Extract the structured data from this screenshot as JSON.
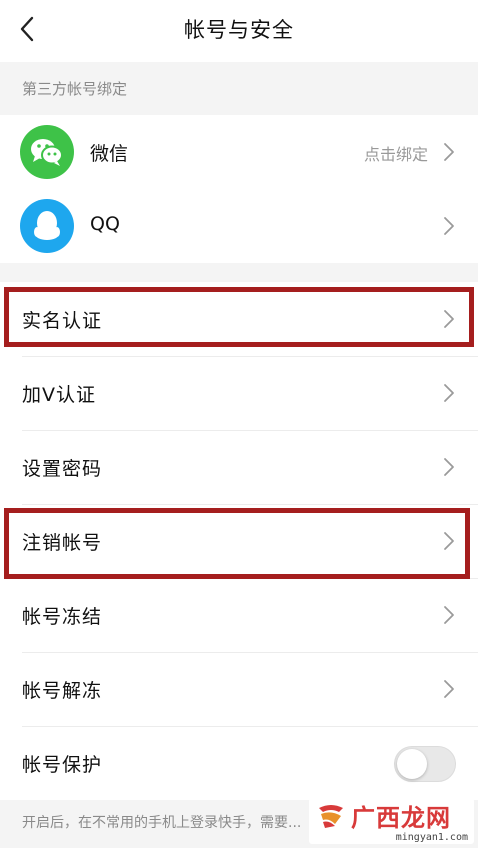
{
  "header": {
    "title": "帐号与安全"
  },
  "third_party": {
    "section_label": "第三方帐号绑定",
    "wechat": {
      "label": "微信",
      "value": "点击绑定"
    },
    "qq": {
      "label": "QQ"
    }
  },
  "items": {
    "real_name": "实名认证",
    "verify_v": "加V认证",
    "password": "设置密码",
    "cancel": "注销帐号",
    "freeze": "帐号冻结",
    "unfreeze": "帐号解冻",
    "protect": "帐号保护"
  },
  "toggle": {
    "on": false
  },
  "footer": {
    "note": "开启后，在不常用的手机上登录快手，需要..."
  },
  "watermark": {
    "text": "广西龙网",
    "url": "mingyan1.com"
  },
  "colors": {
    "highlight": "#a51e1e",
    "wechat": "#3ec248",
    "qq": "#1ea7ee",
    "watermark": "#d83a3a"
  },
  "icons": {
    "back": "chevron-left-icon",
    "row": "chevron-right-icon"
  }
}
